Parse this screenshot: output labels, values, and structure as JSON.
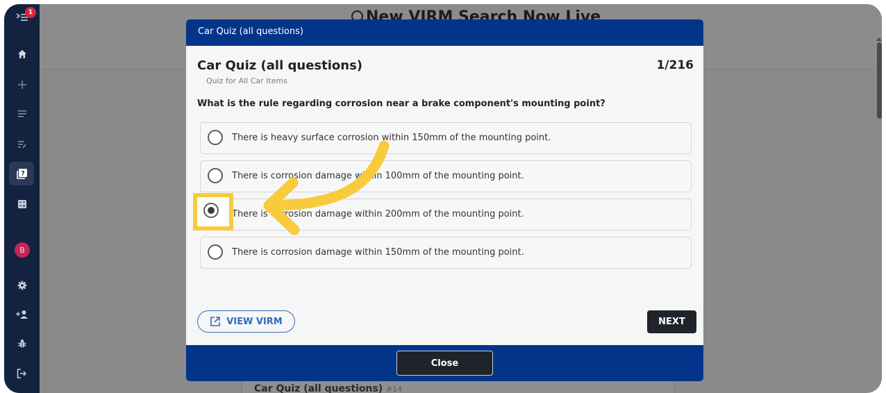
{
  "sidebar": {
    "notification_count": "1",
    "avatar_initial": "B"
  },
  "background": {
    "banner": "New VIRM Search Now Live",
    "card_title": "Car Quiz (all questions)",
    "card_id": "#14"
  },
  "modal": {
    "header": "Car Quiz (all questions)",
    "title": "Car Quiz (all questions)",
    "subtitle": "Quiz for All Car Items",
    "progress": "1/216",
    "question": "What is the rule regarding corrosion near a brake component's mounting point?",
    "options": [
      {
        "label": "There is heavy surface corrosion within 150mm of the mounting point.",
        "selected": false
      },
      {
        "label": "There is corrosion damage within 100mm of the mounting point.",
        "selected": false
      },
      {
        "label": "There is corrosion damage within 200mm of the mounting point.",
        "selected": true
      },
      {
        "label": "There is corrosion damage within 150mm of the mounting point.",
        "selected": false
      }
    ],
    "view_button": "VIEW VIRM",
    "next_button": "NEXT",
    "close_button": "Close"
  },
  "colors": {
    "modal_blue": "#02358a",
    "highlight_yellow": "#f8cb3c",
    "sidebar": "#13233f"
  }
}
